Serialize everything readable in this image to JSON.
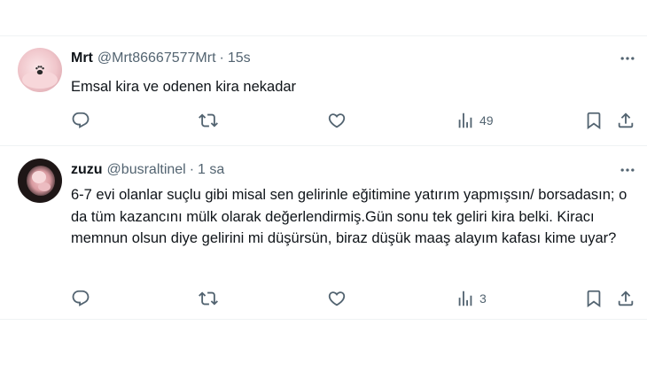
{
  "tweets": [
    {
      "name": "Mrt",
      "handle": "@Mrt86667577Mrt",
      "separator": "·",
      "time": "15s",
      "text": "Emsal kira ve odenen kira nekadar",
      "views": "49",
      "avatar_style": "pink-paw"
    },
    {
      "name": "zuzu",
      "handle": "@busraltinel",
      "separator": "·",
      "time": "1 sa",
      "text": "6-7 evi olanlar suçlu gibi misal sen gelirinle eğitimine yatırım yapmışsın/ borsadasın; o da tüm kazancını mülk olarak değerlendirmiş.Gün sonu tek geliri kira belki. Kiracı memnun olsun diye gelirini mi düşürsün, biraz düşük maaş alayım kafası kime uyar?",
      "views": "3",
      "avatar_style": "dark-photo"
    }
  ],
  "icons": {
    "reply": "reply-icon",
    "retweet": "retweet-icon",
    "like": "like-icon",
    "views": "views-icon",
    "bookmark": "bookmark-icon",
    "share": "share-icon",
    "more": "more-icon"
  },
  "colors": {
    "text": "#0f1419",
    "secondary": "#536471",
    "divider": "#eff3f4"
  }
}
